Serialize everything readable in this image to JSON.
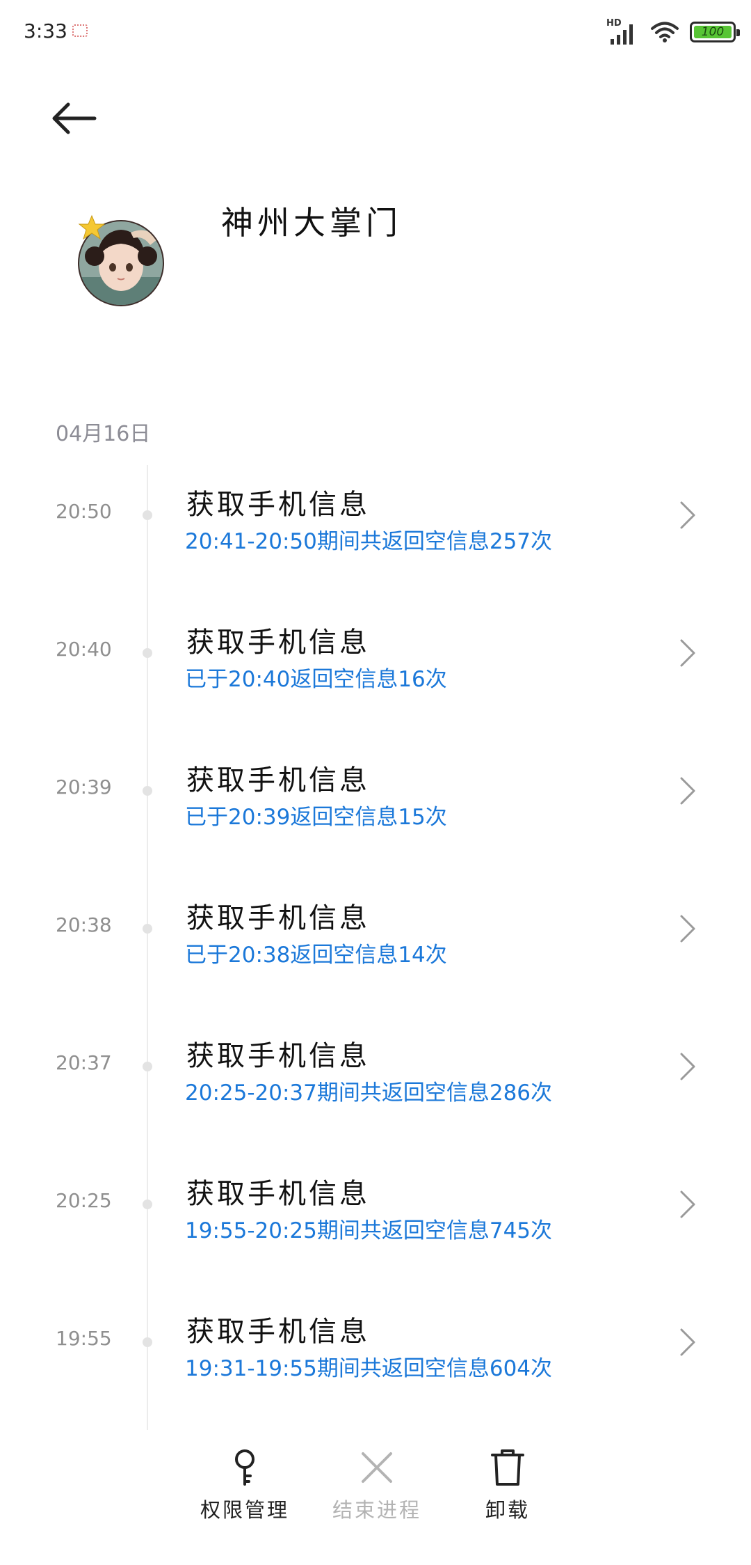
{
  "status_bar": {
    "time": "3:33",
    "network_label": "HD",
    "battery_level": "100",
    "battery_color": "#58c535"
  },
  "header": {
    "back_icon": "arrow-left-icon",
    "app_name": "神州大掌门"
  },
  "timeline": {
    "date": "04月16日",
    "entries": [
      {
        "time": "20:50",
        "title": "获取手机信息",
        "detail": "20:41-20:50期间共返回空信息257次"
      },
      {
        "time": "20:40",
        "title": "获取手机信息",
        "detail": "已于20:40返回空信息16次"
      },
      {
        "time": "20:39",
        "title": "获取手机信息",
        "detail": "已于20:39返回空信息15次"
      },
      {
        "time": "20:38",
        "title": "获取手机信息",
        "detail": "已于20:38返回空信息14次"
      },
      {
        "time": "20:37",
        "title": "获取手机信息",
        "detail": "20:25-20:37期间共返回空信息286次"
      },
      {
        "time": "20:25",
        "title": "获取手机信息",
        "detail": "19:55-20:25期间共返回空信息745次"
      },
      {
        "time": "19:55",
        "title": "获取手机信息",
        "detail": "19:31-19:55期间共返回空信息604次"
      }
    ]
  },
  "actions": {
    "permissions": {
      "label": "权限管理",
      "icon": "key-icon"
    },
    "end_process": {
      "label": "结束进程",
      "icon": "close-icon",
      "disabled": true
    },
    "uninstall": {
      "label": "卸载",
      "icon": "trash-icon"
    }
  },
  "colors": {
    "accent": "#1b78d9",
    "timeline_text": "#8f8f8f",
    "disabled": "#b3b3b3"
  }
}
